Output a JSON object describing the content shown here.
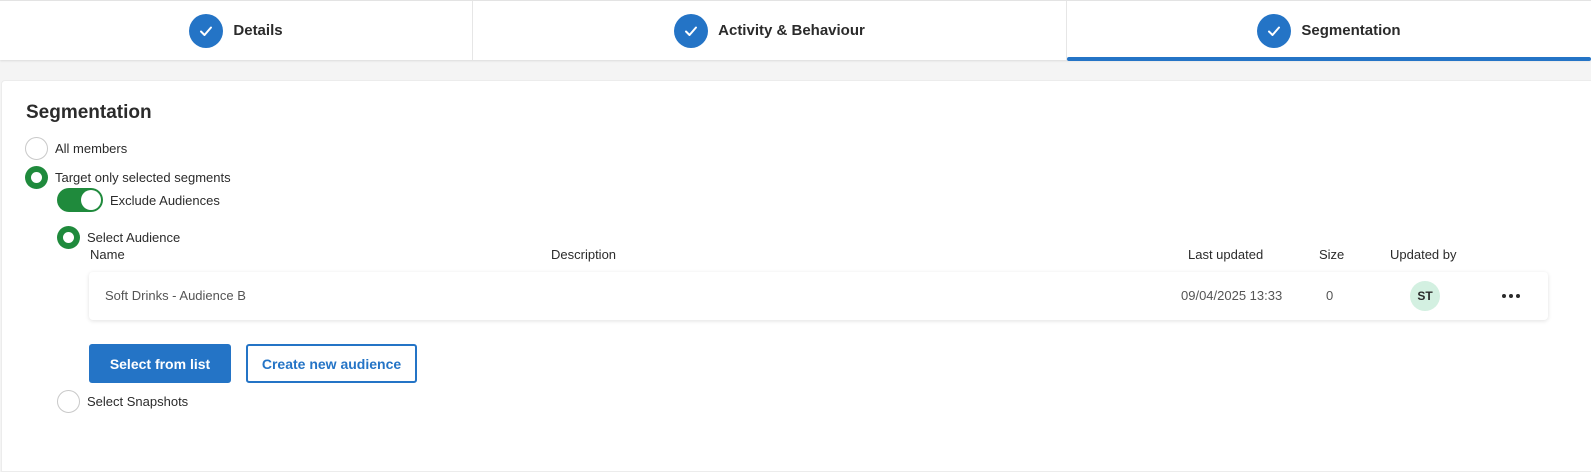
{
  "stepper": {
    "steps": [
      {
        "label": "Details"
      },
      {
        "label": "Activity & Behaviour"
      },
      {
        "label": "Segmentation"
      }
    ]
  },
  "segmentation": {
    "title": "Segmentation",
    "options": {
      "all_members": "All members",
      "target_selected": "Target only selected segments",
      "exclude_audiences": "Exclude Audiences",
      "select_audience": "Select Audience",
      "select_snapshots": "Select Snapshots"
    },
    "table": {
      "headers": {
        "name": "Name",
        "description": "Description",
        "last_updated": "Last updated",
        "size": "Size",
        "updated_by": "Updated by"
      },
      "rows": [
        {
          "name": "Soft Drinks - Audience B",
          "description": "",
          "last_updated": "09/04/2025 13:33",
          "size": "0",
          "updated_by": "ST"
        }
      ]
    },
    "buttons": {
      "select_from_list": "Select from list",
      "create_new_audience": "Create new audience"
    }
  },
  "colors": {
    "accent_blue": "#2474c6",
    "success_green": "#1f8a3c",
    "avatar_bg": "#d3f0e1"
  },
  "icons": {
    "step_complete": "check-icon",
    "row_menu": "more-horizontal-icon"
  }
}
